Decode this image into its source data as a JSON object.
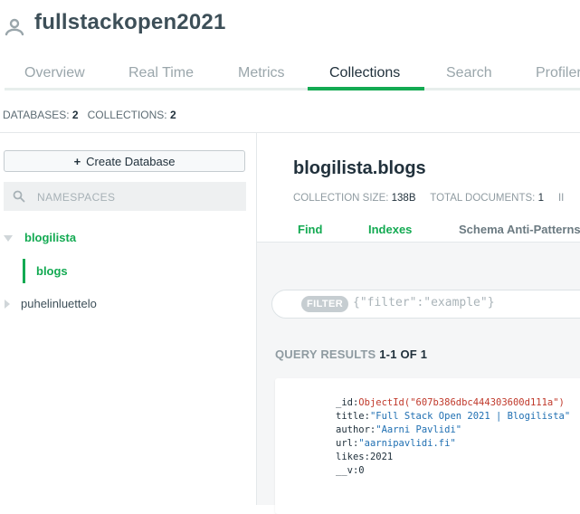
{
  "header": {
    "cluster_name": "fullstackopen2021"
  },
  "tabs": [
    {
      "label": "Overview",
      "active": false
    },
    {
      "label": "Real Time",
      "active": false
    },
    {
      "label": "Metrics",
      "active": false
    },
    {
      "label": "Collections",
      "active": true
    },
    {
      "label": "Search",
      "active": false
    },
    {
      "label": "Profiler",
      "active": false
    }
  ],
  "stats": {
    "databases_label": "DATABASES:",
    "databases_value": "2",
    "collections_label": "COLLECTIONS:",
    "collections_value": "2"
  },
  "sidebar": {
    "create_db_icon": "+",
    "create_db_label": "Create Database",
    "search_placeholder": "NAMESPACES",
    "databases": [
      {
        "name": "blogilista",
        "expanded": true,
        "collections": [
          {
            "name": "blogs",
            "selected": true
          }
        ]
      },
      {
        "name": "puhelinluettelo",
        "expanded": false,
        "collections": []
      }
    ]
  },
  "collection": {
    "title": "blogilista.blogs",
    "size_label": "COLLECTION SIZE:",
    "size_value": "138B",
    "docs_label": "TOTAL DOCUMENTS:",
    "docs_value": "1",
    "extra_label": "II",
    "subtabs": [
      {
        "label": "Find"
      },
      {
        "label": "Indexes"
      },
      {
        "label": "Schema Anti-Patterns"
      }
    ]
  },
  "filter": {
    "badge": "FILTER",
    "placeholder": "{\"filter\":\"example\"}"
  },
  "query_results": {
    "label": "QUERY RESULTS",
    "range": "1-1 OF 1"
  },
  "document": {
    "id_key": "_id:",
    "id_value": "ObjectId(\"607b386dbc444303600d111a\")",
    "title_key": "title:",
    "title_value": "\"Full Stack Open 2021 | Blogilista\"",
    "author_key": "author:",
    "author_value": "\"Aarni Pavlidi\"",
    "url_key": "url:",
    "url_value": "\"aarnipavlidi.fi\"",
    "likes_key": "likes:",
    "likes_value": "2021",
    "v_key": "__v:",
    "v_value": "0"
  },
  "colors": {
    "accent": "#13aa52",
    "text": "#3d4f58",
    "object_id": "#c0392b",
    "string": "#1f6fb2"
  },
  "icons": {
    "user": "user-icon",
    "search": "search-icon",
    "caret_down": "caret-down-icon",
    "caret_right": "caret-right-icon"
  }
}
